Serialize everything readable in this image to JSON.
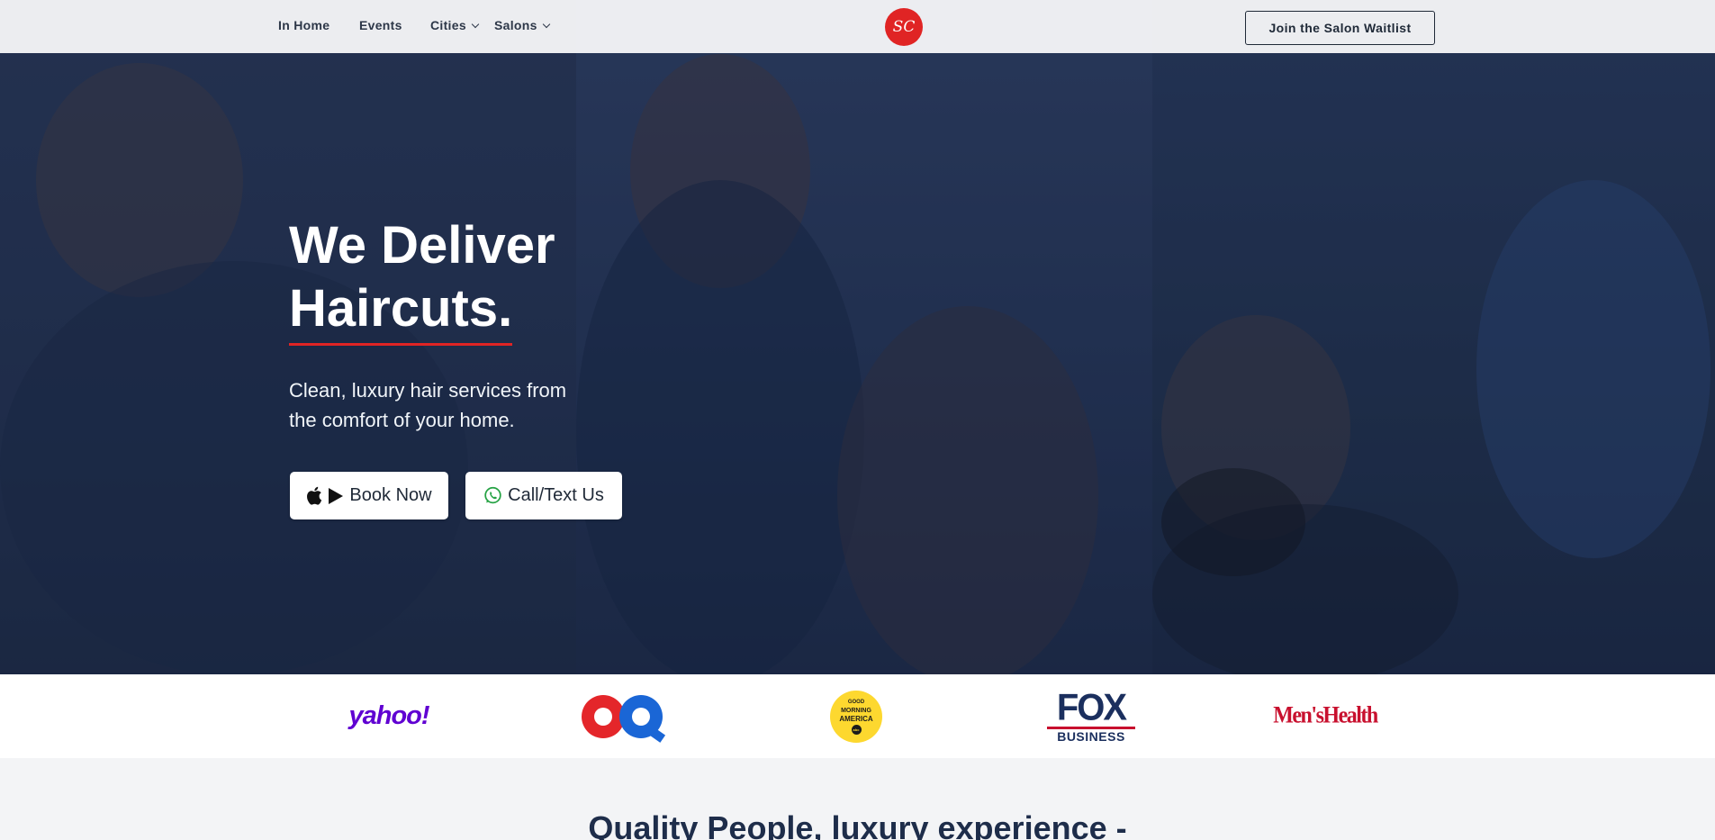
{
  "nav": {
    "items": [
      {
        "label": "In Home"
      },
      {
        "label": "Events"
      },
      {
        "label": "Cities"
      },
      {
        "label": "Salons"
      }
    ],
    "logo_text": "SC",
    "waitlist_label": "Join the Salon Waitlist"
  },
  "hero": {
    "headline_line1": "We Deliver",
    "headline_line2": "Haircuts.",
    "subtitle": "Clean, luxury hair services from the comfort of your home.",
    "book_label": "Book Now",
    "call_label": "Call/Text Us"
  },
  "press": {
    "logos": [
      {
        "name": "yahoo",
        "text": "yahoo!",
        "color": "#6001d2"
      },
      {
        "name": "gq",
        "text": "GQ"
      },
      {
        "name": "good-morning-america",
        "line1": "GOOD",
        "line2": "MORNING",
        "line3": "AMERICA",
        "badge": "abc"
      },
      {
        "name": "fox-business",
        "text": "FOX",
        "sub": "BUSINESS"
      },
      {
        "name": "mens-health",
        "text": "Men'sHealth",
        "color": "#c8102e"
      }
    ]
  },
  "section": {
    "title": "Quality People, luxury experience -"
  },
  "colors": {
    "accent": "#e02424",
    "hero_overlay": "#243352",
    "heading": "#1e2d4a"
  }
}
